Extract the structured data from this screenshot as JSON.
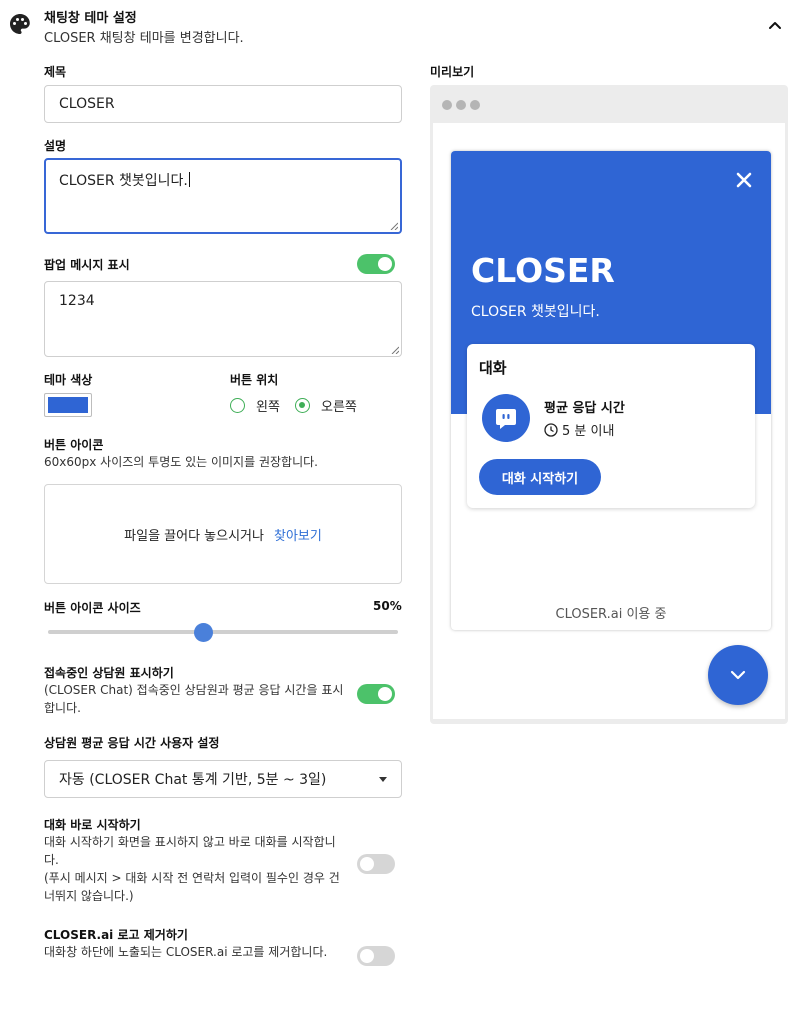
{
  "header": {
    "title": "채팅창 테마 설정",
    "subtitle": "CLOSER 채팅창 테마를 변경합니다."
  },
  "form": {
    "title_label": "제목",
    "title_value": "CLOSER",
    "desc_label": "설명",
    "desc_value": "CLOSER 챗봇입니다.",
    "popup_label": "팝업 메시지 표시",
    "popup_enabled": true,
    "popup_value": "1234",
    "theme_color_label": "테마 색상",
    "theme_color": "#2f65d4",
    "button_position_label": "버튼 위치",
    "position_left": "왼쪽",
    "position_right": "오른쪽",
    "position_selected": "오른쪽",
    "button_icon_label": "버튼 아이콘",
    "button_icon_hint": "60x60px 사이즈의 투명도 있는 이미지를 권장합니다.",
    "dropzone_text": "파일을 끌어다 놓으시거나",
    "dropzone_link": "찾아보기",
    "icon_size_label": "버튼 아이콘 사이즈",
    "icon_size_value": "50%",
    "icon_size_fraction": 0.45,
    "show_agent_label": "접속중인 상담원 표시하기",
    "show_agent_desc": "(CLOSER Chat) 접속중인 상담원과 평균 응답 시간을 표시합니다.",
    "show_agent_enabled": true,
    "avg_time_label": "상담원 평균 응답 시간 사용자 설정",
    "avg_time_selected": "자동 (CLOSER Chat 통계 기반, 5분 ~ 3일)",
    "start_now_label": "대화 바로 시작하기",
    "start_now_desc_1": "대화 시작하기 화면을 표시하지 않고 바로 대화를 시작합니다.",
    "start_now_desc_2": "(푸시 메시지 > 대화 시작 전 연락처 입력이 필수인 경우 건너뛰지 않습니다.)",
    "start_now_enabled": false,
    "remove_logo_label": "CLOSER.ai 로고 제거하기",
    "remove_logo_desc": "대화창 하단에 노출되는 CLOSER.ai 로고를 제거합니다.",
    "remove_logo_enabled": false
  },
  "preview": {
    "label": "미리보기",
    "chat_title": "CLOSER",
    "chat_subtitle": "CLOSER 챗봇입니다.",
    "card_title": "대화",
    "response_label": "평균 응답 시간",
    "response_time": "5 분 이내",
    "start_button": "대화 시작하기",
    "powered_by": "CLOSER.ai 이용 중"
  },
  "colors": {
    "accent": "#2f65d4",
    "toggle_on": "#4cc26a",
    "toggle_off": "#d6d6d6",
    "link": "#2f6fd6"
  },
  "icons": {
    "header": "palette-icon",
    "collapse": "chevron-up-icon",
    "close": "close-icon",
    "avatar": "chat-bubble-icon",
    "time": "clock-icon",
    "fab": "chevron-down-icon"
  }
}
